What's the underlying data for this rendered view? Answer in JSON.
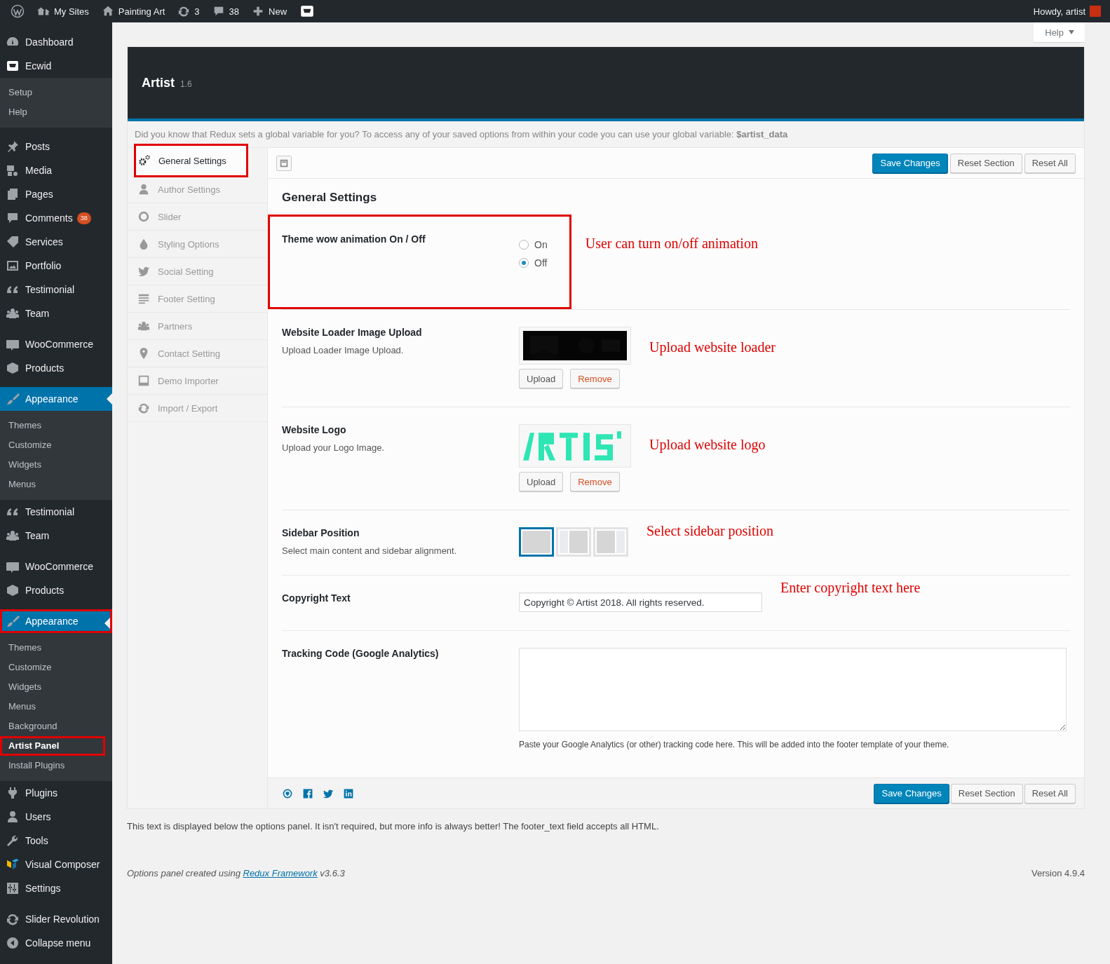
{
  "admin_bar": {
    "items": [
      {
        "label": "My Sites"
      },
      {
        "label": "Painting Art"
      },
      {
        "label": "3"
      },
      {
        "label": "38"
      },
      {
        "label": "New"
      }
    ],
    "greeting": "Howdy, artist"
  },
  "help_tab": {
    "label": "Help"
  },
  "sidebar": {
    "groups": [
      [
        {
          "label": "Dashboard",
          "selected": false,
          "annotated": false
        },
        {
          "label": "Ecwid",
          "selected": false,
          "annotated": false,
          "children": [
            {
              "label": "Setup",
              "selected": false,
              "annotated": false
            },
            {
              "label": "Help",
              "selected": false,
              "annotated": false
            }
          ]
        }
      ],
      [
        {
          "label": "Posts",
          "selected": false,
          "annotated": false
        },
        {
          "label": "Media",
          "selected": false,
          "annotated": false
        },
        {
          "label": "Pages",
          "selected": false,
          "annotated": false
        },
        {
          "label": "Comments",
          "badge": "38",
          "selected": false,
          "annotated": false
        },
        {
          "label": "Services",
          "selected": false,
          "annotated": false
        },
        {
          "label": "Portfolio",
          "selected": false,
          "annotated": false
        },
        {
          "label": "Testimonial",
          "selected": false,
          "annotated": false
        },
        {
          "label": "Team",
          "selected": false,
          "annotated": false
        }
      ],
      [
        {
          "label": "WooCommerce",
          "selected": false,
          "annotated": false
        },
        {
          "label": "Products",
          "selected": false,
          "annotated": false
        }
      ],
      [
        {
          "label": "Appearance",
          "selected": true,
          "annotated": false,
          "children": [
            {
              "label": "Themes",
              "selected": false,
              "annotated": false
            },
            {
              "label": "Customize",
              "selected": false,
              "annotated": false
            },
            {
              "label": "Widgets",
              "selected": false,
              "annotated": false
            },
            {
              "label": "Menus",
              "selected": false,
              "annotated": false
            }
          ]
        },
        {
          "label": "Testimonial",
          "selected": false,
          "annotated": false
        },
        {
          "label": "Team",
          "selected": false,
          "annotated": false
        }
      ],
      [
        {
          "label": "WooCommerce",
          "selected": false,
          "annotated": false
        },
        {
          "label": "Products",
          "selected": false,
          "annotated": false
        }
      ],
      [
        {
          "label": "Appearance",
          "selected": true,
          "annotated": true,
          "children": [
            {
              "label": "Themes",
              "selected": false,
              "annotated": false
            },
            {
              "label": "Customize",
              "selected": false,
              "annotated": false
            },
            {
              "label": "Widgets",
              "selected": false,
              "annotated": false
            },
            {
              "label": "Menus",
              "selected": false,
              "annotated": false
            },
            {
              "label": "Background",
              "selected": false,
              "annotated": false
            },
            {
              "label": "Artist Panel",
              "selected": true,
              "annotated": true
            },
            {
              "label": "Install Plugins",
              "selected": false,
              "annotated": false
            }
          ]
        },
        {
          "label": "Plugins",
          "selected": false,
          "annotated": false
        },
        {
          "label": "Users",
          "selected": false,
          "annotated": false
        },
        {
          "label": "Tools",
          "selected": false,
          "annotated": false
        },
        {
          "label": "Visual Composer",
          "selected": false,
          "annotated": false
        },
        {
          "label": "Settings",
          "selected": false,
          "annotated": false
        }
      ],
      [
        {
          "label": "Slider Revolution",
          "selected": false,
          "annotated": false
        },
        {
          "label": "Collapse menu",
          "selected": false,
          "annotated": false
        }
      ]
    ]
  },
  "panel": {
    "title": "Artist",
    "version": "1.6",
    "notice": "Did you know that Redux sets a global variable for you? To access any of your saved options from within your code you can use your global variable: **$artist_data**",
    "tabs": [
      {
        "label": "General Settings",
        "selected": true,
        "annotated": true
      },
      {
        "label": "Author Settings",
        "selected": false,
        "annotated": false
      },
      {
        "label": "Slider",
        "selected": false,
        "annotated": false
      },
      {
        "label": "Styling Options",
        "selected": false,
        "annotated": false
      },
      {
        "label": "Social Setting",
        "selected": false,
        "annotated": false
      },
      {
        "label": "Footer Setting",
        "selected": false,
        "annotated": false
      },
      {
        "label": "Partners",
        "selected": false,
        "annotated": false
      },
      {
        "label": "Contact Setting",
        "selected": false,
        "annotated": false
      },
      {
        "label": "Demo Importer",
        "selected": false,
        "annotated": false
      },
      {
        "label": "Import / Export",
        "selected": false,
        "annotated": false
      }
    ],
    "buttons": [
      {
        "label": "Save Changes",
        "kind": "primary"
      },
      {
        "label": "Reset Section",
        "kind": "secondary"
      },
      {
        "label": "Reset All",
        "kind": "secondary"
      }
    ],
    "section_title": "General Settings",
    "fields": [
      {
        "kind": "radio",
        "label": "Theme wow animation On / Off",
        "annotated": true,
        "options": [
          {
            "label": "On",
            "selected": false
          },
          {
            "label": "Off",
            "selected": true
          }
        ],
        "note": "User can turn on/off animation"
      },
      {
        "kind": "media",
        "label": "Website Loader Image Upload",
        "description": "Upload Loader Image Upload.",
        "annotated": false,
        "preview": {
          "kind": "picture"
        },
        "buttons": [
          {
            "label": "Upload",
            "kind": "secondary"
          },
          {
            "label": "Remove",
            "kind": "danger"
          }
        ],
        "note": "Upload website loader"
      },
      {
        "kind": "media",
        "label": "Website Logo",
        "description": "Upload your Logo Image.",
        "annotated": false,
        "preview": {
          "kind": "picture"
        },
        "buttons": [
          {
            "label": "Upload",
            "kind": "secondary"
          },
          {
            "label": "Remove",
            "kind": "danger"
          }
        ],
        "note": "Upload website logo"
      },
      {
        "kind": "image_select",
        "label": "Sidebar Position",
        "description": "Select main content and sidebar alignment.",
        "annotated": false,
        "options": [
          {
            "selected": true
          },
          {
            "selected": false
          },
          {
            "selected": false
          }
        ],
        "note": "Select sidebar position"
      },
      {
        "kind": "text",
        "label": "Copyright Text",
        "annotated": false,
        "value": "Copyright © Artist 2018. All rights reserved.",
        "note": "Enter copyright text here"
      },
      {
        "kind": "textarea",
        "label": "Tracking Code (Google Analytics)",
        "annotated": false,
        "help": "Paste your Google Analytics (or other) tracking code here. This will be added into the footer template of your theme."
      }
    ],
    "footer_buttons": [
      {
        "label": "Save Changes",
        "kind": "primary"
      },
      {
        "label": "Reset Section",
        "kind": "secondary"
      },
      {
        "label": "Reset All",
        "kind": "secondary"
      }
    ]
  },
  "footer_text": "This text is displayed below the options panel. It isn't required, but more info is always better! The footer_text field accepts all HTML.",
  "credits": {
    "prefix": "Options panel created using",
    "link": "Redux Framework",
    "suffix": "v3.6.3"
  },
  "version": "Version 4.9.4"
}
